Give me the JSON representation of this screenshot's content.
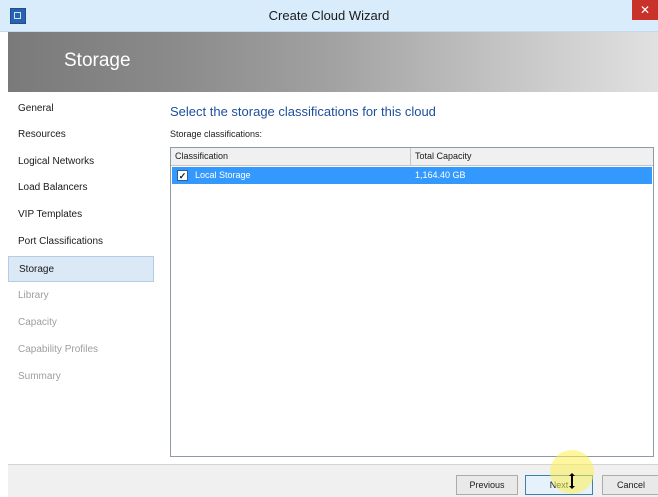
{
  "window": {
    "title": "Create Cloud Wizard",
    "close_glyph": "✕",
    "app_icon": "vmm-app-icon"
  },
  "header": {
    "title": "Storage"
  },
  "sidebar": {
    "items": [
      {
        "label": "General",
        "state": "normal"
      },
      {
        "label": "Resources",
        "state": "normal"
      },
      {
        "label": "Logical Networks",
        "state": "normal"
      },
      {
        "label": "Load Balancers",
        "state": "normal"
      },
      {
        "label": "VIP Templates",
        "state": "normal"
      },
      {
        "label": "Port Classifications",
        "state": "normal"
      },
      {
        "label": "Storage",
        "state": "active"
      },
      {
        "label": "Library",
        "state": "disabled"
      },
      {
        "label": "Capacity",
        "state": "disabled"
      },
      {
        "label": "Capability Profiles",
        "state": "disabled"
      },
      {
        "label": "Summary",
        "state": "disabled"
      }
    ]
  },
  "main": {
    "heading": "Select the storage classifications for this cloud",
    "subheading": "Storage classifications:",
    "table": {
      "columns": [
        "Classification",
        "Total Capacity"
      ],
      "rows": [
        {
          "checked": true,
          "classification": "Local Storage",
          "total_capacity": "1,164.40 GB"
        }
      ]
    }
  },
  "footer": {
    "previous_label": "Previous",
    "next_label": "Next",
    "cancel_label": "Cancel"
  },
  "colors": {
    "selection_blue": "#3399ff",
    "heading_blue": "#1d4f9c",
    "close_red": "#c8322a",
    "active_nav_bg": "#dbe8f6"
  }
}
